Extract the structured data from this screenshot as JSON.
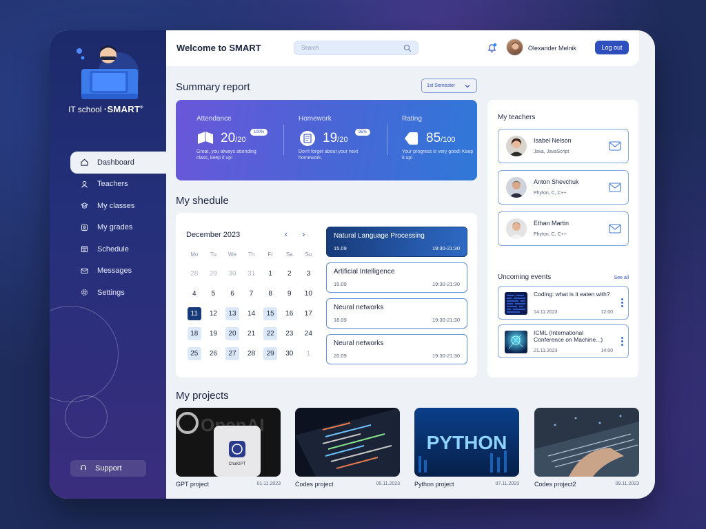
{
  "brand": {
    "prefix": "IT school",
    "name": "SMART",
    "mark": "®"
  },
  "nav": [
    {
      "label": "Dashboard",
      "icon": "home-icon",
      "active": true
    },
    {
      "label": "Teachers",
      "icon": "user-icon"
    },
    {
      "label": "My classes",
      "icon": "graduation-cap-icon"
    },
    {
      "label": "My grades",
      "icon": "grades-icon"
    },
    {
      "label": "Schedule",
      "icon": "calendar-icon"
    },
    {
      "label": "Messages",
      "icon": "messages-icon"
    },
    {
      "label": "Settings",
      "icon": "gear-icon"
    }
  ],
  "support_label": "Support",
  "header": {
    "welcome": "Welcome to SMART",
    "search_placeholder": "Search",
    "user_name": "Olexander Melnik",
    "logout_label": "Log out"
  },
  "summary": {
    "title": "Summary report",
    "semester": "1st Semester",
    "attendance": {
      "title": "Attendance",
      "value": "20",
      "total": "/20",
      "badge": "100%",
      "note": "Great, you always attending class, keep it up!"
    },
    "homework": {
      "title": "Homework",
      "value": "19",
      "total": "/20",
      "badge": "95%",
      "note": "Don't forget about your next homework."
    },
    "rating": {
      "title": "Rating",
      "value": "85",
      "total": "/100",
      "note": "Your progress is very good! Keep it up!"
    }
  },
  "schedule": {
    "title": "My shedule",
    "month": "December 2023",
    "prev": "‹",
    "next": "›",
    "weekdays": [
      "Mo",
      "Tu",
      "We",
      "Th",
      "Fr",
      "Sa",
      "Su"
    ],
    "days": [
      {
        "d": "28",
        "t": "muted"
      },
      {
        "d": "29",
        "t": "muted"
      },
      {
        "d": "30",
        "t": "muted"
      },
      {
        "d": "31",
        "t": "muted"
      },
      {
        "d": "1"
      },
      {
        "d": "2"
      },
      {
        "d": "3"
      },
      {
        "d": "4"
      },
      {
        "d": "5"
      },
      {
        "d": "6"
      },
      {
        "d": "7"
      },
      {
        "d": "8"
      },
      {
        "d": "9"
      },
      {
        "d": "10"
      },
      {
        "d": "11",
        "t": "sel"
      },
      {
        "d": "12"
      },
      {
        "d": "13",
        "t": "hl"
      },
      {
        "d": "14"
      },
      {
        "d": "15",
        "t": "hl"
      },
      {
        "d": "16"
      },
      {
        "d": "17"
      },
      {
        "d": "18",
        "t": "hl"
      },
      {
        "d": "19"
      },
      {
        "d": "20",
        "t": "hl"
      },
      {
        "d": "21"
      },
      {
        "d": "22",
        "t": "hl"
      },
      {
        "d": "23"
      },
      {
        "d": "24"
      },
      {
        "d": "25",
        "t": "hl"
      },
      {
        "d": "26"
      },
      {
        "d": "27",
        "t": "hl"
      },
      {
        "d": "28"
      },
      {
        "d": "29",
        "t": "hl"
      },
      {
        "d": "30"
      },
      {
        "d": "1",
        "t": "muted"
      }
    ],
    "lessons": [
      {
        "name": "Natural Language Processing",
        "date": "15.09",
        "time": "19:30-21:30",
        "active": true
      },
      {
        "name": "Artificial Intelligence",
        "date": "15.09",
        "time": "19:30-21:30"
      },
      {
        "name": "Neural networks",
        "date": "18.09",
        "time": "19:30-21:30"
      },
      {
        "name": "Neural networks",
        "date": "20.09",
        "time": "19:30-21:30"
      }
    ]
  },
  "teachers": {
    "title": "My teachers",
    "items": [
      {
        "name": "Isabel Nelson",
        "subjects": "Java, JavaScript"
      },
      {
        "name": "Anton Shevchuk",
        "subjects": "Phyton, C, C++"
      },
      {
        "name": "Ethan Martin",
        "subjects": "Phyton, C, C++"
      }
    ]
  },
  "events": {
    "title": "Uncoming events",
    "see_all": "See all",
    "items": [
      {
        "name": "Coding: what is it eaten with?",
        "date": "14.11.2023",
        "time": "12:00"
      },
      {
        "name": "ICML (International Conference on Machine...)",
        "date": "21.11.2023",
        "time": "14:00"
      }
    ]
  },
  "projects": {
    "title": "My projects",
    "items": [
      {
        "name": "GPT project",
        "date": "01.11.2023",
        "art_text": "OpenAI",
        "badge": "ChatGPT"
      },
      {
        "name": "Codes project",
        "date": "05.11.2023"
      },
      {
        "name": "Python project",
        "date": "07.11.2023",
        "art_text": "PYTHON"
      },
      {
        "name": "Codes project2",
        "date": "09.11.2023"
      }
    ]
  },
  "colors": {
    "accent": "#2f4fbf",
    "sidebar": "#1c2a6b",
    "selected_day": "#173b79"
  }
}
